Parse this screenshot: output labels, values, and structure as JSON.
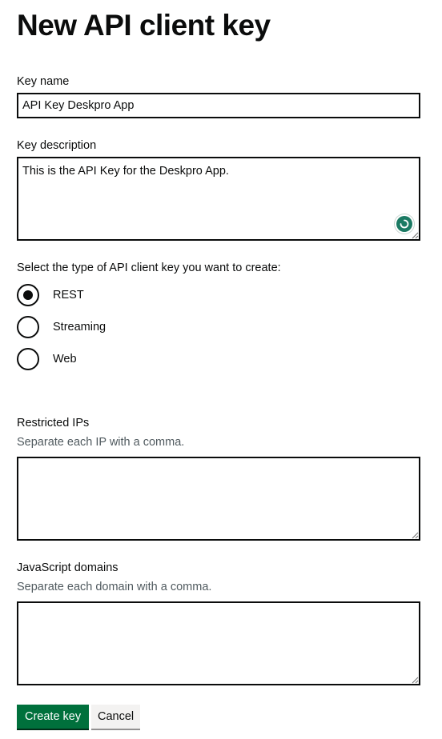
{
  "page": {
    "title": "New API client key"
  },
  "key_name": {
    "label": "Key name",
    "value": "API Key Deskpro App"
  },
  "key_description": {
    "label": "Key description",
    "value": "This is the API Key for the Deskpro App."
  },
  "key_type": {
    "legend": "Select the type of API client key you want to create:",
    "selected": "REST",
    "options": [
      {
        "label": "REST",
        "checked": true
      },
      {
        "label": "Streaming",
        "checked": false
      },
      {
        "label": "Web",
        "checked": false
      }
    ]
  },
  "restricted_ips": {
    "label": "Restricted IPs",
    "hint": "Separate each IP with a comma.",
    "value": ""
  },
  "javascript_domains": {
    "label": "JavaScript domains",
    "hint": "Separate each domain with a comma.",
    "value": ""
  },
  "actions": {
    "create_label": "Create key",
    "cancel_label": "Cancel"
  },
  "colors": {
    "primary_button": "#00703c",
    "secondary_button": "#f3f2f1",
    "text": "#0b0c0c",
    "hint_text": "#505a5f",
    "grammar_icon": "#1b7a63"
  },
  "icons": {
    "grammar_assistant": "grammar-assistant-icon",
    "resize_handle": "resize-handle-icon"
  }
}
